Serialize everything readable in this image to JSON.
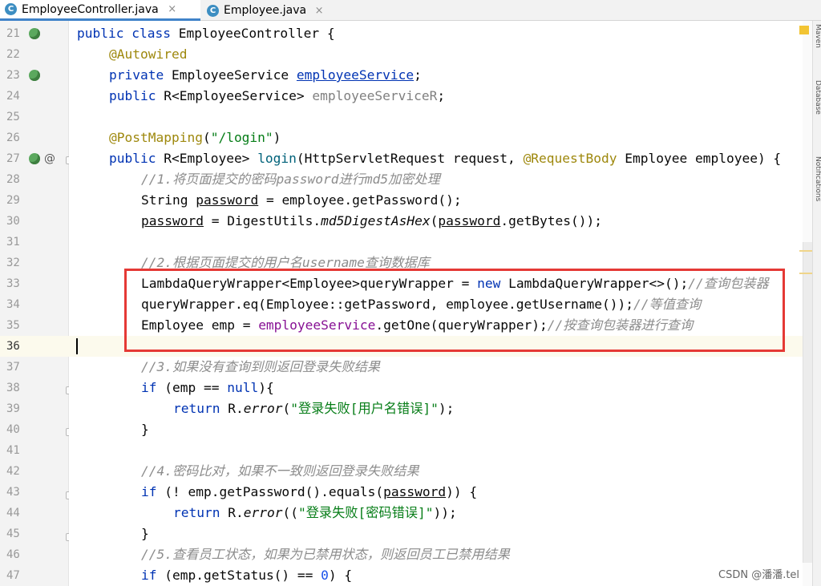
{
  "tabs": [
    {
      "label": "EmployeeController.java",
      "active": true,
      "icon": "java-class-icon",
      "glyph": "C"
    },
    {
      "label": "Employee.java",
      "active": false,
      "icon": "java-class-icon",
      "glyph": "C"
    }
  ],
  "tab_close_glyph": "×",
  "line_numbers": [
    "21",
    "22",
    "23",
    "24",
    "25",
    "26",
    "27",
    "28",
    "29",
    "30",
    "31",
    "32",
    "33",
    "34",
    "35",
    "36",
    "37",
    "38",
    "39",
    "40",
    "41",
    "42",
    "43",
    "44",
    "45",
    "46",
    "47"
  ],
  "code": {
    "l21": {
      "kw1": "public class",
      "rest": " EmployeeController {"
    },
    "l22": {
      "ann": "@Autowired"
    },
    "l23": {
      "kw": "private",
      "type": " EmployeeService ",
      "field": "employeeService",
      "end": ";"
    },
    "l24": {
      "kw": "public",
      "type": " R<EmployeeService> ",
      "unused": "employeeServiceR",
      "end": ";"
    },
    "l26": {
      "ann": "@PostMapping",
      "p1": "(",
      "str": "\"/login\"",
      "p2": ")"
    },
    "l27": {
      "kw": "public",
      "type": " R<Employee> ",
      "method": "login",
      "a": "(HttpServletRequest request, ",
      "ann": "@RequestBody",
      "b": " Employee employee) {"
    },
    "l28": {
      "comment": "//1.将页面提交的密码password进行md5加密处理"
    },
    "l29": {
      "a": "String ",
      "var": "password",
      "b": " = employee.getPassword();"
    },
    "l30": {
      "var": "password",
      "a": " = DigestUtils.",
      "static": "md5DigestAsHex",
      "b": "(",
      "var2": "password",
      "c": ".getBytes());"
    },
    "l32": {
      "comment": "//2.根据页面提交的用户名username查询数据库"
    },
    "l33": {
      "a": "LambdaQueryWrapper<Employee>queryWrapper = ",
      "kw": "new",
      "b": " LambdaQueryWrapper<>();",
      "comment": "//查询包装器"
    },
    "l34": {
      "a": "queryWrapper.eq(Employee::getPassword, employee.getUsername());",
      "comment": "//等值查询"
    },
    "l35": {
      "a": "Employee emp = ",
      "field": "employeeService",
      "b": ".getOne(queryWrapper);",
      "comment": "//按查询包装器进行查询"
    },
    "l37": {
      "comment": "//3.如果没有查询到则返回登录失败结果"
    },
    "l38": {
      "kw": "if",
      "a": " (emp == ",
      "kw2": "null",
      "b": "){"
    },
    "l39": {
      "kw": "return",
      "a": " R.",
      "static": "error",
      "b": "(",
      "str": "\"登录失败[用户名错误]\"",
      "c": ");"
    },
    "l40": {
      "a": "}"
    },
    "l42": {
      "comment": "//4.密码比对，如果不一致则返回登录失败结果"
    },
    "l43": {
      "kw": "if",
      "a": " (! emp.getPassword().equals(",
      "var": "password",
      "b": ")) {"
    },
    "l44": {
      "kw": "return",
      "a": " R.",
      "static": "error",
      "b": "((",
      "str": "\"登录失败[密码错误]\"",
      "c": "));"
    },
    "l45": {
      "a": "}"
    },
    "l46": {
      "comment": "//5.查看员工状态，如果为已禁用状态，则返回员工已禁用结果"
    },
    "l47": {
      "kw": "if",
      "a": " (emp.getStatus() == ",
      "num": "0",
      "b": ") {"
    }
  },
  "gutter_at": "@",
  "side_labels": [
    "Maven",
    "Database",
    "Notifications"
  ],
  "watermark": "CSDN @潘潘.tel",
  "colors": {
    "keyword": "#0033b3",
    "annotation": "#9e880d",
    "string": "#067d17",
    "comment": "#8c8c8c",
    "field": "#871094",
    "highlight_box": "#e53935",
    "tab_accent": "#4083c9"
  }
}
